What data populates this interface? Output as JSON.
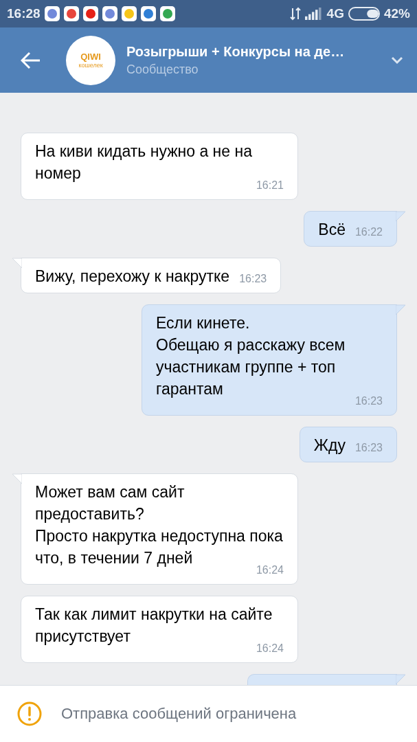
{
  "status_bar": {
    "time": "16:28",
    "network": "4G",
    "battery": "42%",
    "notifications": [
      {
        "color": "#7289da"
      },
      {
        "color": "#e8453c"
      },
      {
        "color": "#e62117"
      },
      {
        "color": "#7289da"
      },
      {
        "color": "#f5c518"
      },
      {
        "color": "#2f7fd6"
      },
      {
        "color": "#34a853"
      }
    ]
  },
  "header": {
    "title": "Розыгрыши + Конкурсы на де…",
    "subtitle": "Сообщество",
    "avatar_text": "QIWI",
    "avatar_subtext": "кошелек"
  },
  "messages": [
    {
      "kind": "in",
      "text": "На киви кидать нужно а не на номер",
      "time": "16:21"
    },
    {
      "kind": "out",
      "text": "Всё",
      "time": "16:22",
      "tail": true
    },
    {
      "kind": "in",
      "text": "Вижу, перехожу к накрутке",
      "time": "16:23",
      "tail": true
    },
    {
      "kind": "out",
      "text": "Если кинете.\nОбещаю я расскажу всем участникам группе + топ гарантам",
      "time": "16:23",
      "tail": true
    },
    {
      "kind": "out",
      "text": "Жду",
      "time": "16:23",
      "tail": false
    },
    {
      "kind": "in",
      "text": "Может вам сам сайт предоставить?\nПросто накрутка недоступна пока что, в течении 7 дней",
      "time": "16:24",
      "tail": true
    },
    {
      "kind": "in",
      "text": "Так как лимит накрутки на сайте присутствует",
      "time": "16:24",
      "tail": false
    },
    {
      "kind": "out_stub",
      "tail": true
    }
  ],
  "notice": {
    "text": "Отправка сообщений ограничена"
  }
}
